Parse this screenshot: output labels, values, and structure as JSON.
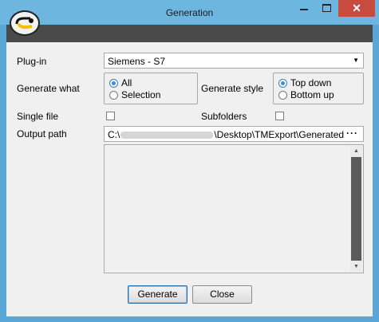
{
  "window": {
    "title": "Generation",
    "close_glyph": "✕"
  },
  "icons": {
    "app_logo": "app-logo-icon",
    "minimize": "minimize-icon",
    "maximize": "maximize-icon",
    "close": "close-icon",
    "dropdown": "chevron-down-icon"
  },
  "form": {
    "plugin_label": "Plug-in",
    "plugin_value": "Siemens - S7",
    "generate_what_label": "Generate what",
    "generate_what_options": [
      {
        "label": "All",
        "selected": true
      },
      {
        "label": "Selection",
        "selected": false
      }
    ],
    "generate_style_label": "Generate style",
    "generate_style_options": [
      {
        "label": "Top down",
        "selected": true
      },
      {
        "label": "Bottom up",
        "selected": false
      }
    ],
    "single_file_label": "Single file",
    "single_file_checked": false,
    "subfolders_label": "Subfolders",
    "subfolders_checked": false,
    "output_path_label": "Output path",
    "output_path_prefix": "C:\\",
    "output_path_suffix": "\\Desktop\\TMExport\\Generated",
    "browse_label": "···",
    "log_text": ""
  },
  "buttons": {
    "generate": "Generate",
    "close": "Close"
  }
}
